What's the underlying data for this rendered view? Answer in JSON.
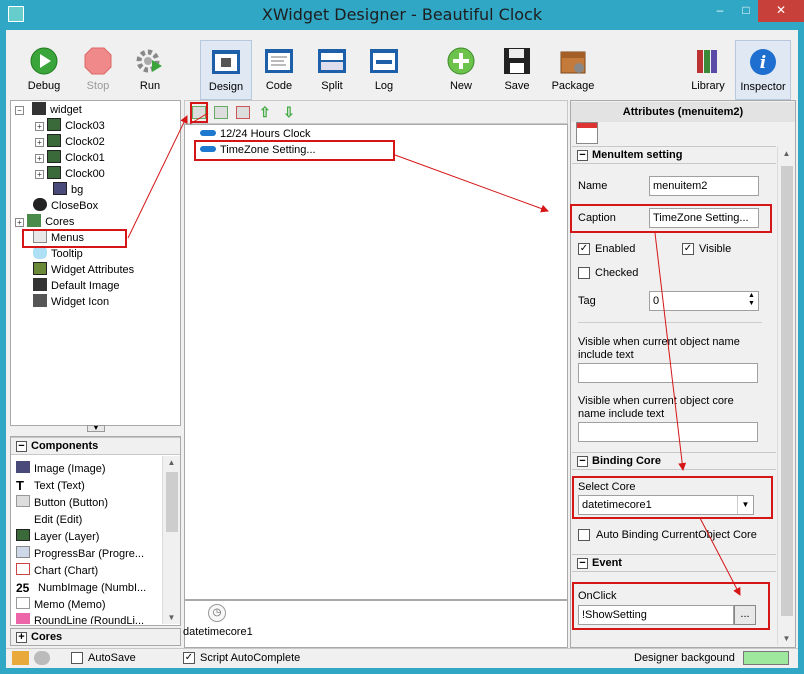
{
  "window": {
    "title": "XWidget Designer - Beautiful Clock",
    "minimize": "–",
    "maximize": "□",
    "close": "✕"
  },
  "toolbar": {
    "debug": "Debug",
    "stop": "Stop",
    "run": "Run",
    "design": "Design",
    "code": "Code",
    "split": "Split",
    "log": "Log",
    "new": "New",
    "save": "Save",
    "package": "Package",
    "library": "Library",
    "inspector": "Inspector"
  },
  "tree": {
    "root": "widget",
    "items": [
      "Clock03",
      "Clock02",
      "Clock01",
      "Clock00",
      "bg",
      "CloseBox",
      "Cores",
      "Menus",
      "Tooltip",
      "Widget Attributes",
      "Default Image",
      "Widget Icon"
    ]
  },
  "components": {
    "header": "Components",
    "items": [
      "Image (Image)",
      "Text (Text)",
      "Button (Button)",
      "Edit (Edit)",
      "Layer (Layer)",
      "ProgressBar (Progre...",
      "Chart (Chart)",
      "NumbImage (NumbI...",
      "Memo (Memo)",
      "RoundLine (RoundLi..."
    ]
  },
  "cores_section": {
    "header": "Cores"
  },
  "menu_editor": {
    "items": [
      "12/24 Hours Clock",
      "TimeZone Setting..."
    ],
    "core_label": "datetimecore1"
  },
  "attributes": {
    "header": "Attributes (menuitem2)",
    "section_menuitem": "MenuItem setting",
    "name_label": "Name",
    "name_value": "menuitem2",
    "caption_label": "Caption",
    "caption_value": "TimeZone Setting...",
    "enabled_label": "Enabled",
    "visible_label": "Visible",
    "checked_label": "Checked",
    "tag_label": "Tag",
    "tag_value": "0",
    "visible_name_label": "Visible when current object name include text",
    "visible_core_label": "Visible when current object core name include text",
    "section_binding": "Binding Core",
    "select_core_label": "Select Core",
    "select_core_value": "datetimecore1",
    "auto_binding_label": "Auto Binding CurrentObject Core",
    "section_event": "Event",
    "onclick_label": "OnClick",
    "onclick_value": "!ShowSetting",
    "browse_button": "..."
  },
  "statusbar": {
    "autosave": "AutoSave",
    "script_autocomplete": "Script AutoComplete",
    "designer_background": "Designer backgound"
  },
  "colors": {
    "frame": "#2fa7c5",
    "highlight": "#d51616",
    "designer_bg_swatch": "#9ee89e"
  }
}
